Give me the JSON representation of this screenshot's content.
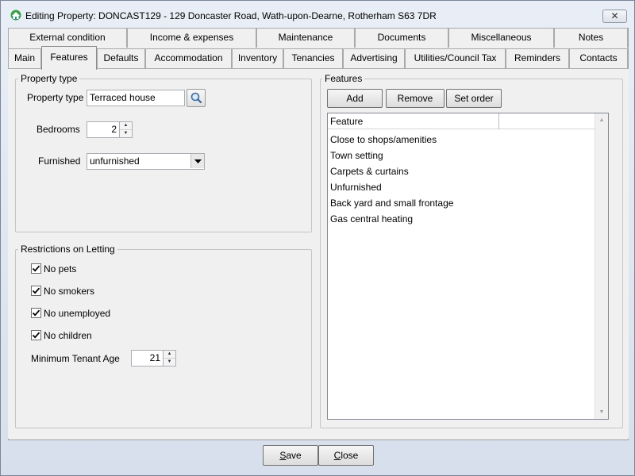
{
  "window": {
    "title": "Editing Property: DONCAST129 - 129 Doncaster Road, Wath-upon-Dearne, Rotherham S63 7DR",
    "close_glyph": "✕"
  },
  "tabs_row1": [
    {
      "label": "External condition"
    },
    {
      "label": "Income & expenses"
    },
    {
      "label": "Maintenance"
    },
    {
      "label": "Documents"
    },
    {
      "label": "Miscellaneous"
    },
    {
      "label": "Notes"
    }
  ],
  "tabs_row2": [
    {
      "label": "Main"
    },
    {
      "label": "Features"
    },
    {
      "label": "Defaults"
    },
    {
      "label": "Accommodation"
    },
    {
      "label": "Inventory"
    },
    {
      "label": "Tenancies"
    },
    {
      "label": "Advertising"
    },
    {
      "label": "Utilities/Council Tax"
    },
    {
      "label": "Reminders"
    },
    {
      "label": "Contacts"
    }
  ],
  "active_tab": "Features",
  "property_type_group": {
    "title": "Property type",
    "property_type_label": "Property type",
    "property_type_value": "Terraced house",
    "bedrooms_label": "Bedrooms",
    "bedrooms_value": "2",
    "furnished_label": "Furnished",
    "furnished_value": "unfurnished"
  },
  "restrictions_group": {
    "title": "Restrictions on Letting",
    "checkboxes": [
      {
        "label": "No pets",
        "checked": true
      },
      {
        "label": "No smokers",
        "checked": true
      },
      {
        "label": "No unemployed",
        "checked": true
      },
      {
        "label": "No children",
        "checked": true
      }
    ],
    "min_age_label": "Minimum Tenant Age",
    "min_age_value": "21"
  },
  "features_group": {
    "title": "Features",
    "add_label": "Add",
    "remove_label": "Remove",
    "set_order_label": "Set order",
    "column_header": "Feature",
    "items": [
      "Close to shops/amenities",
      "Town setting",
      "Carpets & curtains",
      "Unfurnished",
      "Back yard and small frontage",
      "Gas central heating"
    ]
  },
  "footer": {
    "save_label_accel": "S",
    "save_label_rest": "ave",
    "close_label_accel": "C",
    "close_label_rest": "lose"
  },
  "colors": {
    "window_bg": "#f0f0f0",
    "titlebar_bg": "#d6dfeb",
    "check_mark": "#000000"
  }
}
